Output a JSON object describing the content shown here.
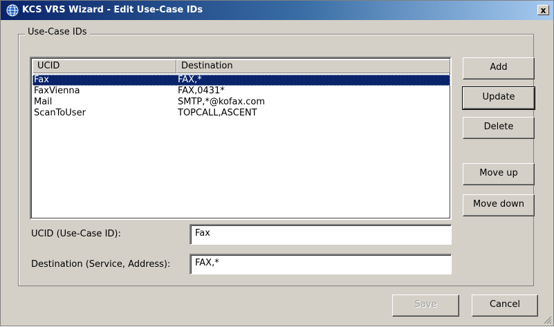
{
  "window": {
    "title": "KCS VRS Wizard - Edit Use-Case IDs",
    "close_glyph": "x"
  },
  "group": {
    "label": "Use-Case IDs"
  },
  "list": {
    "columns": [
      "UCID",
      "Destination"
    ],
    "rows": [
      {
        "ucid": "Fax",
        "destination": "FAX,*",
        "selected": true
      },
      {
        "ucid": "FaxVienna",
        "destination": "FAX,0431*",
        "selected": false
      },
      {
        "ucid": "Mail",
        "destination": "SMTP,*@kofax.com",
        "selected": false
      },
      {
        "ucid": "ScanToUser",
        "destination": "TOPCALL,ASCENT",
        "selected": false
      }
    ]
  },
  "buttons": {
    "add": "Add",
    "update": "Update",
    "delete": "Delete",
    "move_up": "Move up",
    "move_down": "Move down",
    "save": "Save",
    "cancel": "Cancel"
  },
  "form": {
    "ucid_label": "UCID (Use-Case ID):",
    "ucid_value": "Fax",
    "destination_label": "Destination (Service, Address):",
    "destination_value": "FAX,*"
  },
  "icons": {
    "app": "globe-icon",
    "close": "close-icon",
    "resize": "resize-grip-icon"
  },
  "colors": {
    "selection": "#0a246a",
    "titlebar_start": "#0a246a",
    "face": "#d4d0c8"
  }
}
